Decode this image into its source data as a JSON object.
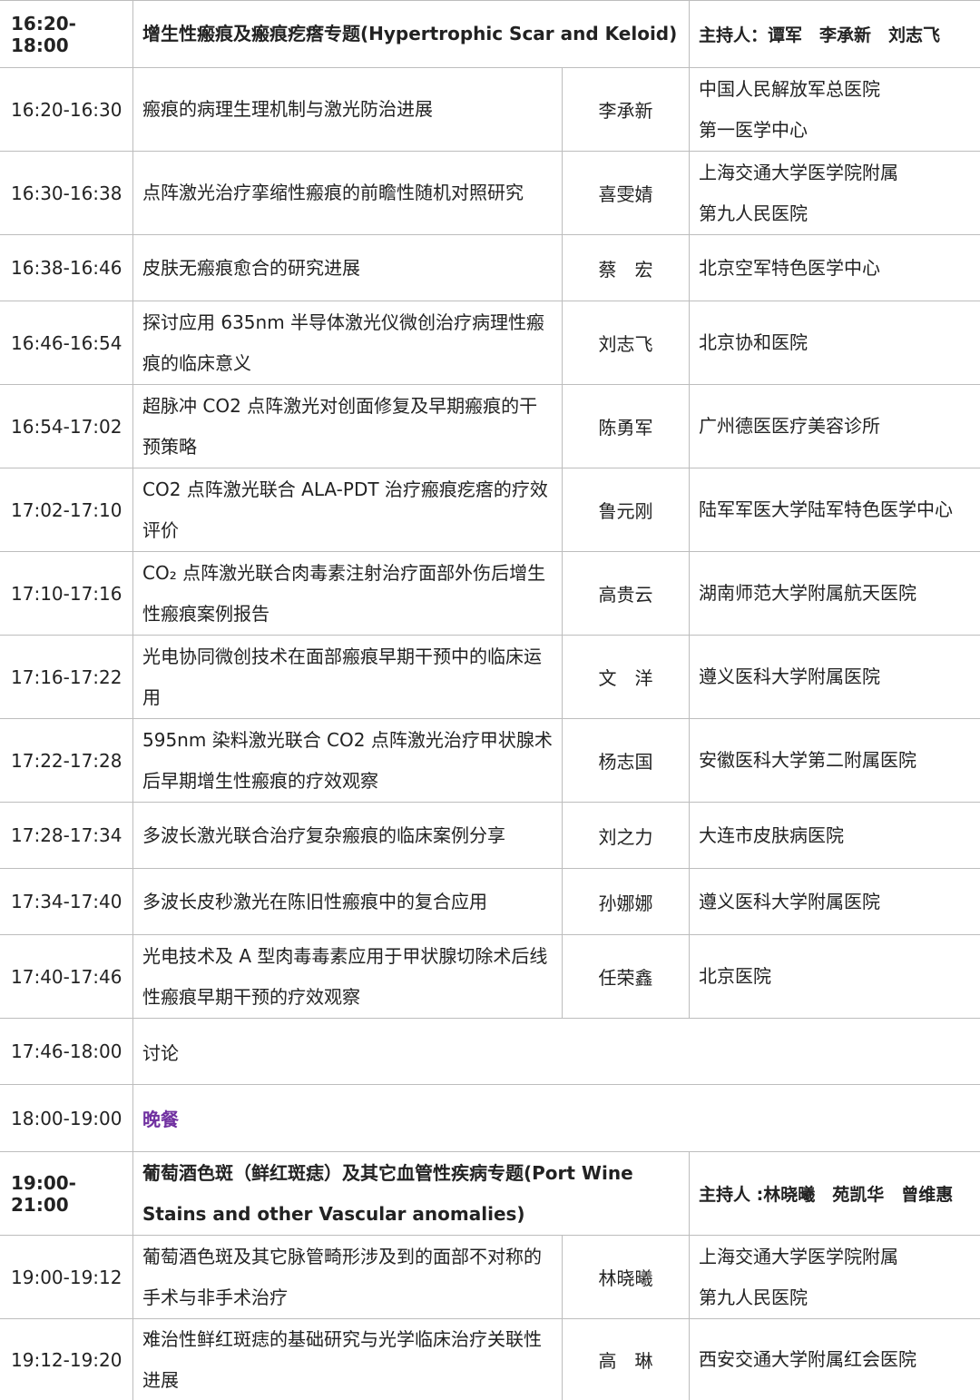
{
  "session1": {
    "time": "16:20-18:00",
    "title": "增生性瘢痕及瘢痕疙瘩专题(Hypertrophic Scar and Keloid)",
    "hosts": "主持人：谭军　李承新　刘志飞"
  },
  "talks1": [
    {
      "time": "16:20-16:30",
      "topic": "瘢痕的病理生理机制与激光防治进展",
      "speaker": "李承新",
      "institution": "中国人民解放军总医院第一医学中心"
    },
    {
      "time": "16:30-16:38",
      "topic": "点阵激光治疗挛缩性瘢痕的前瞻性随机对照研究",
      "speaker": "喜雯婧",
      "institution": "上海交通大学医学院附属第九人民医院"
    },
    {
      "time": "16:38-16:46",
      "topic": "皮肤无瘢痕愈合的研究进展",
      "speaker": "蔡　宏",
      "institution": "北京空军特色医学中心"
    },
    {
      "time": "16:46-16:54",
      "topic": "探讨应用 635nm 半导体激光仪微创治疗病理性瘢痕的临床意义",
      "speaker": "刘志飞",
      "institution": "北京协和医院"
    },
    {
      "time": "16:54-17:02",
      "topic": "超脉冲 CO2 点阵激光对创面修复及早期瘢痕的干预策略",
      "speaker": "陈勇军",
      "institution": "广州德医医疗美容诊所"
    },
    {
      "time": "17:02-17:10",
      "topic": "CO2 点阵激光联合 ALA-PDT 治疗瘢痕疙瘩的疗效评价",
      "speaker": "鲁元刚",
      "institution": "陆军军医大学陆军特色医学中心"
    },
    {
      "time": "17:10-17:16",
      "topic": "CO₂ 点阵激光联合肉毒素注射治疗面部外伤后增生性瘢痕案例报告",
      "speaker": "高贵云",
      "institution": "湖南师范大学附属航天医院"
    },
    {
      "time": "17:16-17:22",
      "topic": "光电协同微创技术在面部瘢痕早期干预中的临床运用",
      "speaker": "文　洋",
      "institution": "遵义医科大学附属医院"
    },
    {
      "time": "17:22-17:28",
      "topic": "595nm 染料激光联合 CO2 点阵激光治疗甲状腺术后早期增生性瘢痕的疗效观察",
      "speaker": "杨志国",
      "institution": "安徽医科大学第二附属医院"
    },
    {
      "time": "17:28-17:34",
      "topic": "多波长激光联合治疗复杂瘢痕的临床案例分享",
      "speaker": "刘之力",
      "institution": "大连市皮肤病医院"
    },
    {
      "time": "17:34-17:40",
      "topic": "多波长皮秒激光在陈旧性瘢痕中的复合应用",
      "speaker": "孙娜娜",
      "institution": "遵义医科大学附属医院"
    },
    {
      "time": "17:40-17:46",
      "topic": "光电技术及 A 型肉毒毒素应用于甲状腺切除术后线性瘢痕早期干预的疗效观察",
      "speaker": "任荣鑫",
      "institution": "北京医院"
    }
  ],
  "discussion": {
    "time": "17:46-18:00",
    "label": "讨论"
  },
  "dinner": {
    "time": "18:00-19:00",
    "label": "晚餐",
    "color": "#7030a0"
  },
  "session2": {
    "time": "19:00-21:00",
    "title": "葡萄酒色斑（鲜红斑痣）及其它血管性疾病专题(Port Wine Stains and other Vascular anomalies)",
    "hosts": "主持人 :林晓曦　苑凯华　曾维惠"
  },
  "talks2": [
    {
      "time": "19:00-19:12",
      "topic": "葡萄酒色斑及其它脉管畸形涉及到的面部不对称的手术与非手术治疗",
      "speaker": "林晓曦",
      "institution": "上海交通大学医学院附属第九人民医院"
    },
    {
      "time": "19:12-19:20",
      "topic": "难治性鲜红斑痣的基础研究与光学临床治疗关联性进展",
      "speaker": "高　琳",
      "institution": "西安交通大学附属红会医院"
    }
  ]
}
